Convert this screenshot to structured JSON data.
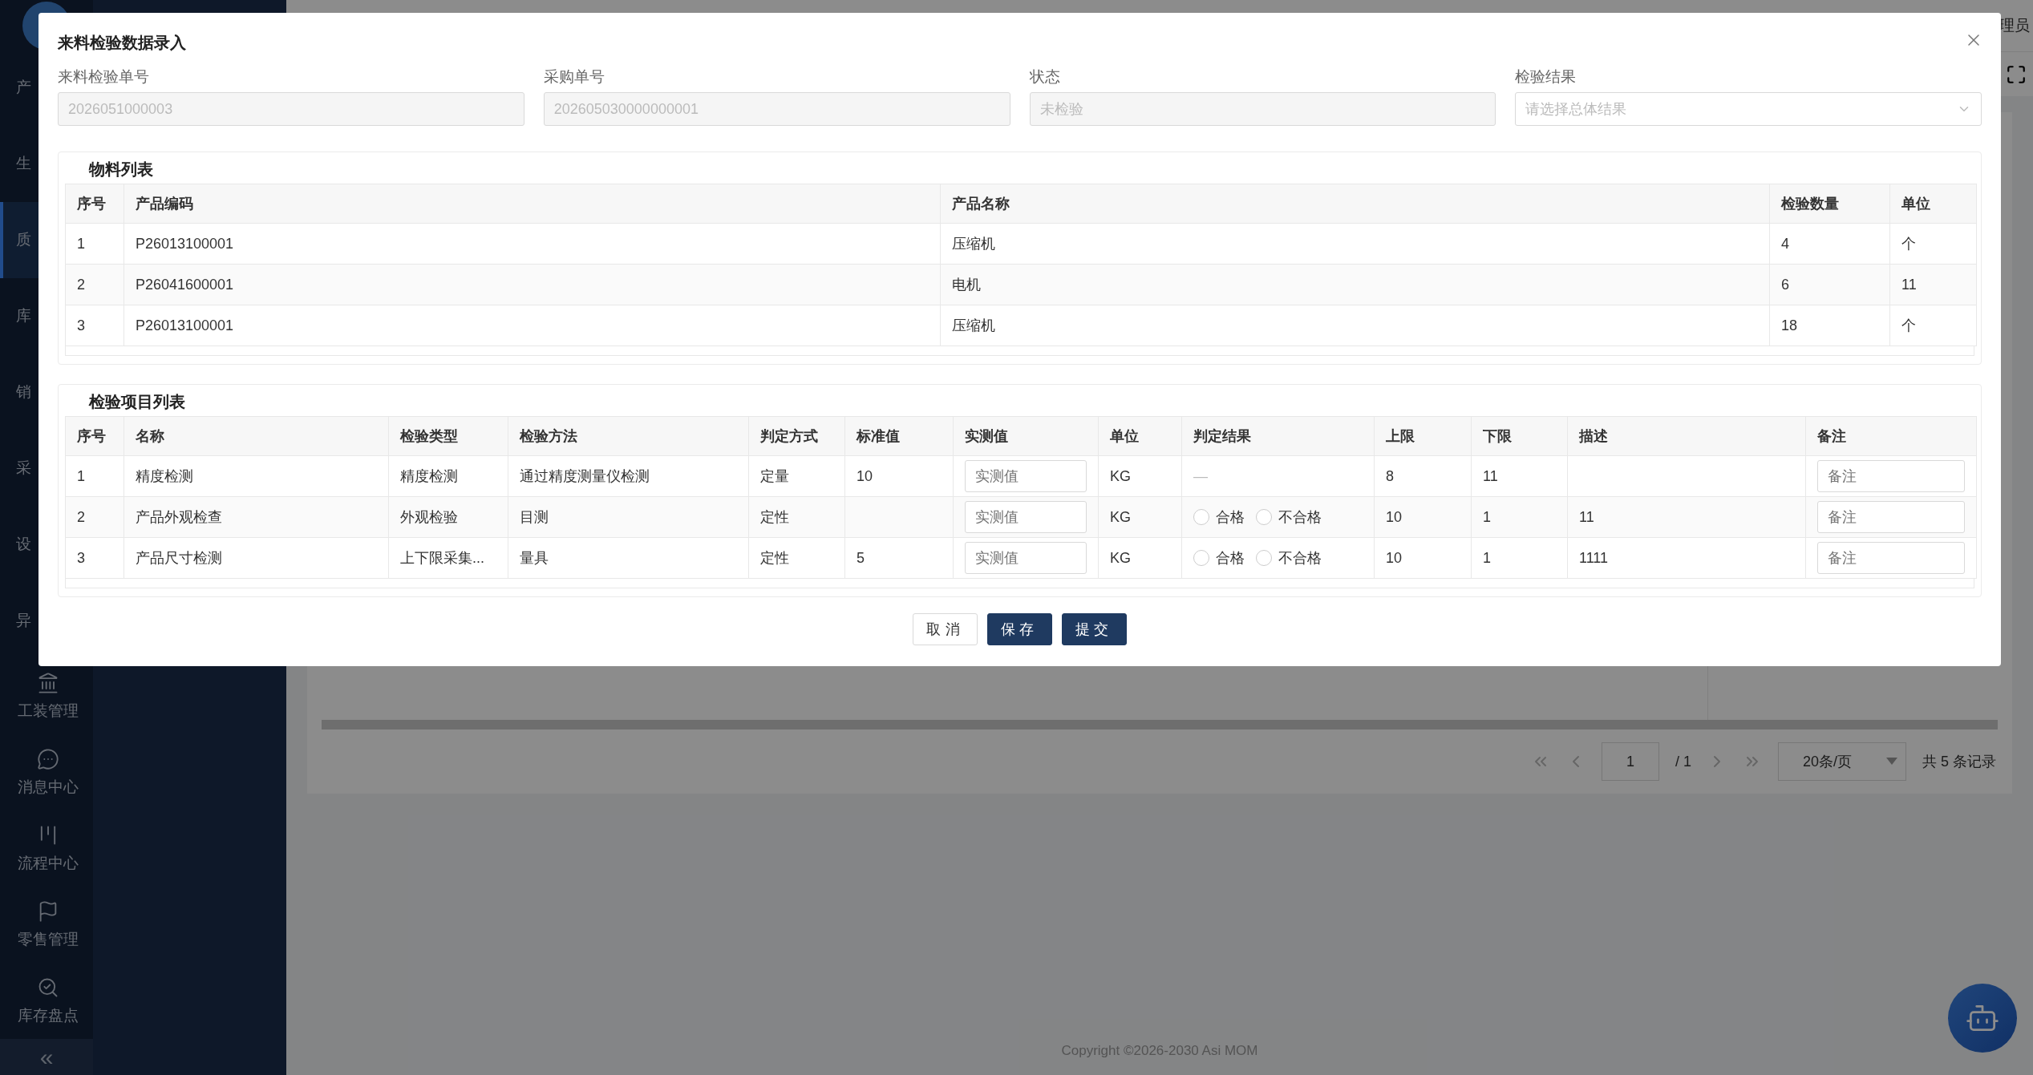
{
  "sidebar": {
    "partial_items": [
      {
        "label": "产",
        "selected": false
      },
      {
        "label": "生",
        "selected": false
      },
      {
        "label": "质",
        "selected": true
      },
      {
        "label": "库",
        "selected": false
      },
      {
        "label": "销",
        "selected": false
      },
      {
        "label": "采",
        "selected": false
      },
      {
        "label": "设",
        "selected": false
      },
      {
        "label": "异",
        "selected": false
      }
    ],
    "items": [
      {
        "label": "工装管理",
        "selected": false
      },
      {
        "label": "消息中心",
        "selected": false
      },
      {
        "label": "流程中心",
        "selected": false
      },
      {
        "label": "零售管理",
        "selected": false
      },
      {
        "label": "库存盘点",
        "selected": false
      }
    ],
    "collapse": "«"
  },
  "header": {
    "user": "理员"
  },
  "pagination": {
    "page": "1",
    "total_pages": "/ 1",
    "page_size": "20条/页",
    "summary": "共 5 条记录"
  },
  "footer": {
    "copyright": "Copyright ©2026-2030 Asi MOM"
  },
  "modal": {
    "title": "来料检验数据录入",
    "fields": [
      {
        "kind": "input",
        "label": "来料检验单号",
        "value": "2026051000003"
      },
      {
        "kind": "input",
        "label": "采购单号",
        "value": "202605030000000001"
      },
      {
        "kind": "input",
        "label": "状态",
        "value": "未检验"
      },
      {
        "kind": "select",
        "label": "检验结果",
        "placeholder": "请选择总体结果"
      }
    ],
    "materials": {
      "title": "物料列表",
      "columns": [
        "序号",
        "产品编码",
        "产品名称",
        "检验数量",
        "单位"
      ],
      "rows": [
        [
          "1",
          "P26013100001",
          "压缩机",
          "4",
          "个"
        ],
        [
          "2",
          "P26041600001",
          "电机",
          "6",
          "11"
        ],
        [
          "3",
          "P26013100001",
          "压缩机",
          "18",
          "个"
        ]
      ]
    },
    "inspection": {
      "title": "检验项目列表",
      "columns": [
        "序号",
        "名称",
        "检验类型",
        "检验方法",
        "判定方式",
        "标准值",
        "实测值",
        "单位",
        "判定结果",
        "上限",
        "下限",
        "描述",
        "备注"
      ],
      "rows": [
        {
          "no": "1",
          "name": "精度检测",
          "type": "精度检测",
          "method": "通过精度测量仪检测",
          "mode": "定量",
          "standard": "10",
          "measured_placeholder": "实测值",
          "unit": "KG",
          "result": {
            "kind": "dash",
            "text": "—"
          },
          "upper": "8",
          "lower": "11",
          "description": "",
          "remark_placeholder": "备注"
        },
        {
          "no": "2",
          "name": "产品外观检查",
          "type": "外观检验",
          "method": "目测",
          "mode": "定性",
          "standard": "",
          "measured_placeholder": "实测值",
          "unit": "KG",
          "result": {
            "kind": "radio",
            "options": [
              {
                "label": "合格",
                "selected": false
              },
              {
                "label": "不合格",
                "selected": false
              }
            ]
          },
          "upper": "10",
          "lower": "1",
          "description": "11",
          "remark_placeholder": "备注"
        },
        {
          "no": "3",
          "name": "产品尺寸检测",
          "type": "上下限采集...",
          "method": "量具",
          "mode": "定性",
          "standard": "5",
          "measured_placeholder": "实测值",
          "unit": "KG",
          "result": {
            "kind": "radio",
            "options": [
              {
                "label": "合格",
                "selected": false
              },
              {
                "label": "不合格",
                "selected": false
              }
            ]
          },
          "upper": "10",
          "lower": "1",
          "description": "1111",
          "remark_placeholder": "备注"
        }
      ]
    },
    "buttons": [
      {
        "kind": "default",
        "label": "取消"
      },
      {
        "kind": "primary",
        "label": "保存"
      },
      {
        "kind": "primary",
        "label": "提交"
      }
    ]
  }
}
